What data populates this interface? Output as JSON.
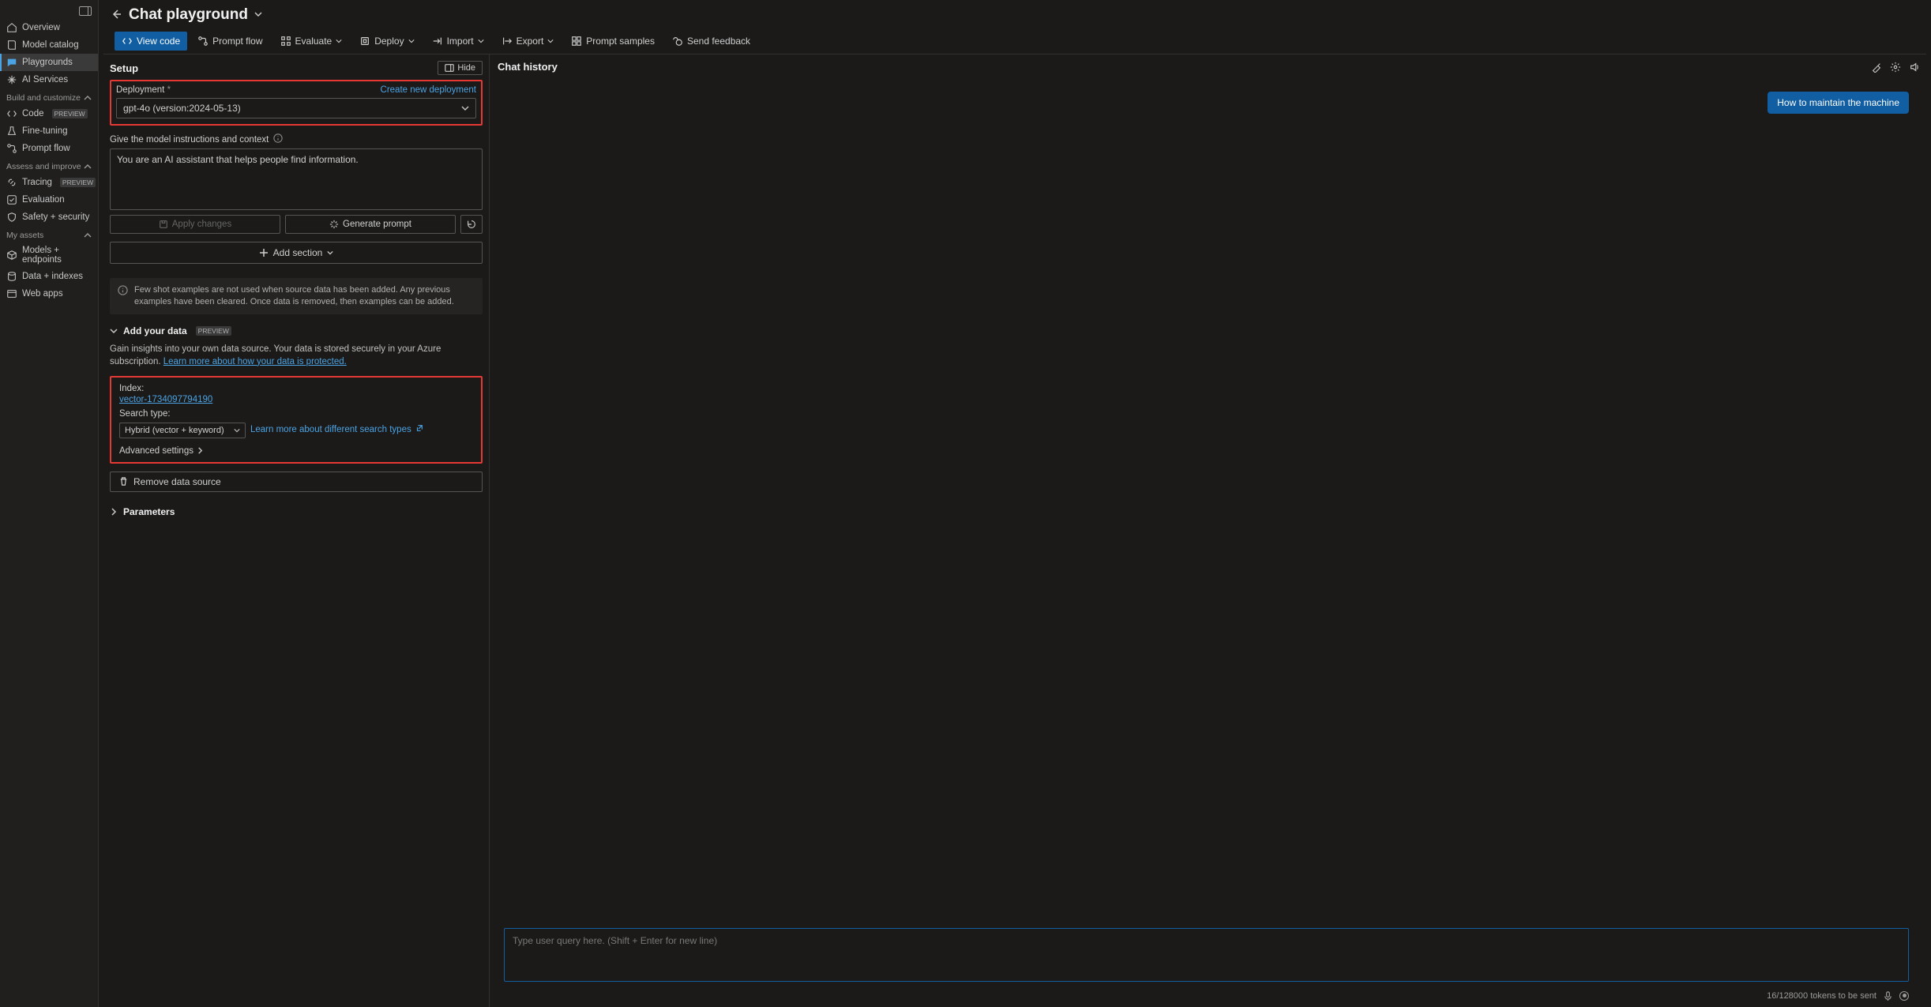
{
  "title": "Chat playground",
  "sidebar": {
    "top": [
      {
        "label": "Overview",
        "icon": "home"
      },
      {
        "label": "Model catalog",
        "icon": "book"
      },
      {
        "label": "Playgrounds",
        "icon": "chat",
        "active": true
      },
      {
        "label": "AI Services",
        "icon": "sparkle"
      }
    ],
    "groups": [
      {
        "label": "Build and customize",
        "items": [
          {
            "label": "Code",
            "icon": "code",
            "preview": "PREVIEW"
          },
          {
            "label": "Fine-tuning",
            "icon": "flask"
          },
          {
            "label": "Prompt flow",
            "icon": "flow"
          }
        ]
      },
      {
        "label": "Assess and improve",
        "items": [
          {
            "label": "Tracing",
            "icon": "link",
            "preview": "PREVIEW"
          },
          {
            "label": "Evaluation",
            "icon": "check"
          },
          {
            "label": "Safety + security",
            "icon": "shield"
          }
        ]
      },
      {
        "label": "My assets",
        "items": [
          {
            "label": "Models + endpoints",
            "icon": "cube"
          },
          {
            "label": "Data + indexes",
            "icon": "db"
          },
          {
            "label": "Web apps",
            "icon": "globe"
          }
        ]
      }
    ]
  },
  "toolbar": {
    "view_code": "View code",
    "prompt_flow": "Prompt flow",
    "evaluate": "Evaluate",
    "deploy": "Deploy",
    "import": "Import",
    "export": "Export",
    "prompt_samples": "Prompt samples",
    "send_feedback": "Send feedback"
  },
  "setup": {
    "title": "Setup",
    "hide": "Hide",
    "deployment_label": "Deployment",
    "create_new": "Create new deployment",
    "deployment_value": "gpt-4o (version:2024-05-13)",
    "instructions_label": "Give the model instructions and context",
    "instructions_value": "You are an AI assistant that helps people find information.",
    "apply_changes": "Apply changes",
    "generate_prompt": "Generate prompt",
    "add_section": "Add section",
    "few_shot_info": "Few shot examples are not used when source data has been added. Any previous examples have been cleared. Once data is removed, then examples can be added.",
    "add_data_title": "Add your data",
    "add_data_preview": "PREVIEW",
    "add_data_desc": "Gain insights into your own data source. Your data is stored securely in your Azure subscription. ",
    "add_data_link": "Learn more about how your data is protected.",
    "index_label": "Index:",
    "index_value": "vector-1734097794190",
    "search_type_label": "Search type:",
    "search_type_value": "Hybrid (vector + keyword)",
    "search_types_link": "Learn more about different search types",
    "advanced": "Advanced settings",
    "remove_source": "Remove data source",
    "parameters": "Parameters"
  },
  "chat": {
    "title": "Chat history",
    "pill": "How to maintain the machine",
    "placeholder": "Type user query here. (Shift + Enter for new line)",
    "tokens": "16/128000 tokens to be sent"
  }
}
